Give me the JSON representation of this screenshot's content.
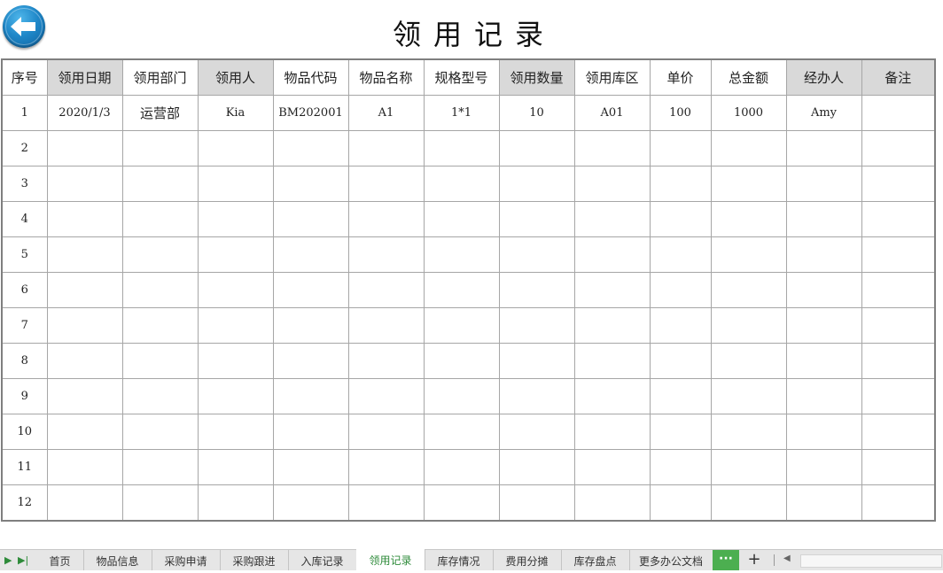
{
  "title": "领用记录",
  "back_button_icon": "back-arrow-icon",
  "colors": {
    "header_shade": "#d9d9d9",
    "grid_line": "#a6a6a6",
    "active_tab_text": "#2e8b3a",
    "more_button": "#4caf50",
    "back_button": "#1f88c9"
  },
  "table": {
    "headers": [
      "序号",
      "领用日期",
      "领用部门",
      "领用人",
      "物品代码",
      "物品名称",
      "规格型号",
      "领用数量",
      "领用库区",
      "单价",
      "总金额",
      "经办人",
      "备注"
    ],
    "shaded_headers": [
      1,
      3,
      7,
      11,
      12
    ],
    "rows": [
      [
        "1",
        "2020/1/3",
        "运营部",
        "Kia",
        "BM202001",
        "A1",
        "1*1",
        "10",
        "A01",
        "100",
        "1000",
        "Amy",
        ""
      ],
      [
        "2",
        "",
        "",
        "",
        "",
        "",
        "",
        "",
        "",
        "",
        "",
        "",
        ""
      ],
      [
        "3",
        "",
        "",
        "",
        "",
        "",
        "",
        "",
        "",
        "",
        "",
        "",
        ""
      ],
      [
        "4",
        "",
        "",
        "",
        "",
        "",
        "",
        "",
        "",
        "",
        "",
        "",
        ""
      ],
      [
        "5",
        "",
        "",
        "",
        "",
        "",
        "",
        "",
        "",
        "",
        "",
        "",
        ""
      ],
      [
        "6",
        "",
        "",
        "",
        "",
        "",
        "",
        "",
        "",
        "",
        "",
        "",
        ""
      ],
      [
        "7",
        "",
        "",
        "",
        "",
        "",
        "",
        "",
        "",
        "",
        "",
        "",
        ""
      ],
      [
        "8",
        "",
        "",
        "",
        "",
        "",
        "",
        "",
        "",
        "",
        "",
        "",
        ""
      ],
      [
        "9",
        "",
        "",
        "",
        "",
        "",
        "",
        "",
        "",
        "",
        "",
        "",
        ""
      ],
      [
        "10",
        "",
        "",
        "",
        "",
        "",
        "",
        "",
        "",
        "",
        "",
        "",
        ""
      ],
      [
        "11",
        "",
        "",
        "",
        "",
        "",
        "",
        "",
        "",
        "",
        "",
        "",
        ""
      ],
      [
        "12",
        "",
        "",
        "",
        "",
        "",
        "",
        "",
        "",
        "",
        "",
        "",
        ""
      ]
    ]
  },
  "tabs": [
    "首页",
    "物品信息",
    "采购申请",
    "采购跟进",
    "入库记录",
    "领用记录",
    "库存情况",
    "费用分摊",
    "库存盘点",
    "更多办公文档"
  ],
  "active_tab": "领用记录",
  "more_label": "···",
  "add_label": "+"
}
